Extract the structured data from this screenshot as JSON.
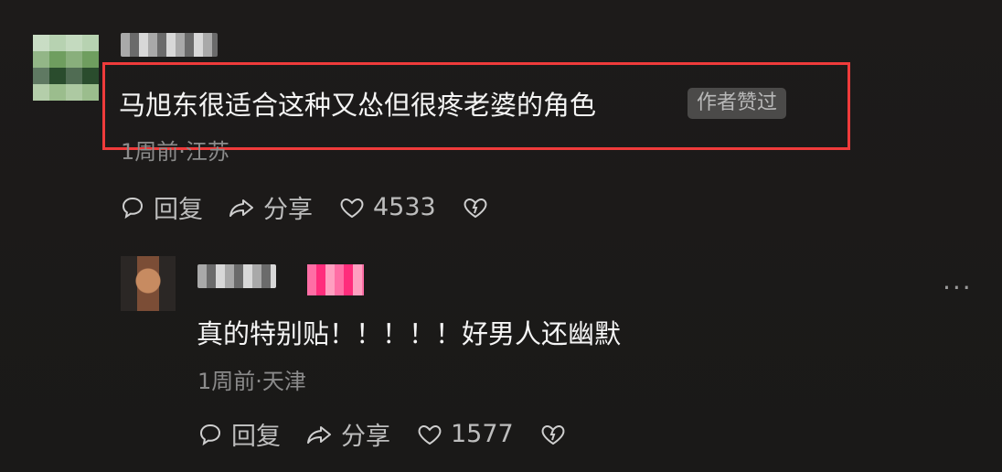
{
  "comment": {
    "text": "马旭东很适合这种又怂但很疼老婆的角色",
    "badge": "作者赞过",
    "meta": "1周前·江苏",
    "actions": {
      "reply": "回复",
      "share": "分享",
      "likes": "4533"
    }
  },
  "reply": {
    "text": "真的特别贴！！！！！好男人还幽默",
    "meta": "1周前·天津",
    "actions": {
      "reply": "回复",
      "share": "分享",
      "likes": "1577"
    },
    "more": "···"
  }
}
